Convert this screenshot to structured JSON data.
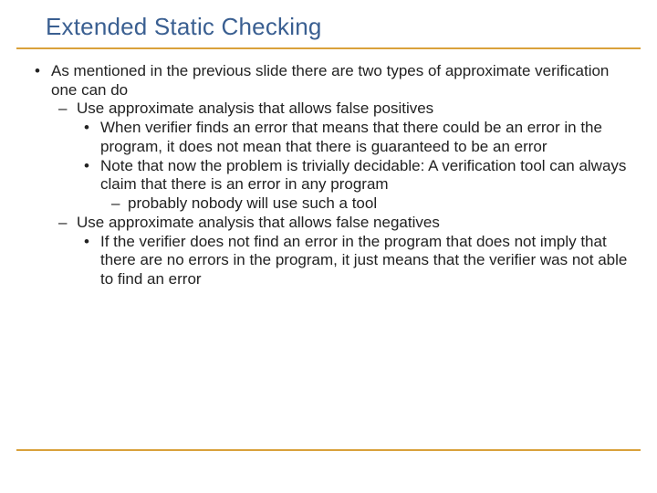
{
  "title": "Extended Static Checking",
  "content": {
    "l1": "As mentioned in the previous slide there are two types of approximate verification one can do",
    "l2a": "Use approximate analysis that allows false positives",
    "l3a": "When verifier finds an error that means that there could be an error in the program, it does not mean that there is guaranteed to be an error",
    "l3b": "Note that now the problem is trivially decidable: A verification tool can always claim that there is an error in any program",
    "l4a": "probably nobody will use such a tool",
    "l2b": "Use approximate analysis that allows false negatives",
    "l3c": "If  the verifier does not find an error in the program that does not imply that there are no errors in the program, it just means that the verifier was not able to find an error"
  }
}
